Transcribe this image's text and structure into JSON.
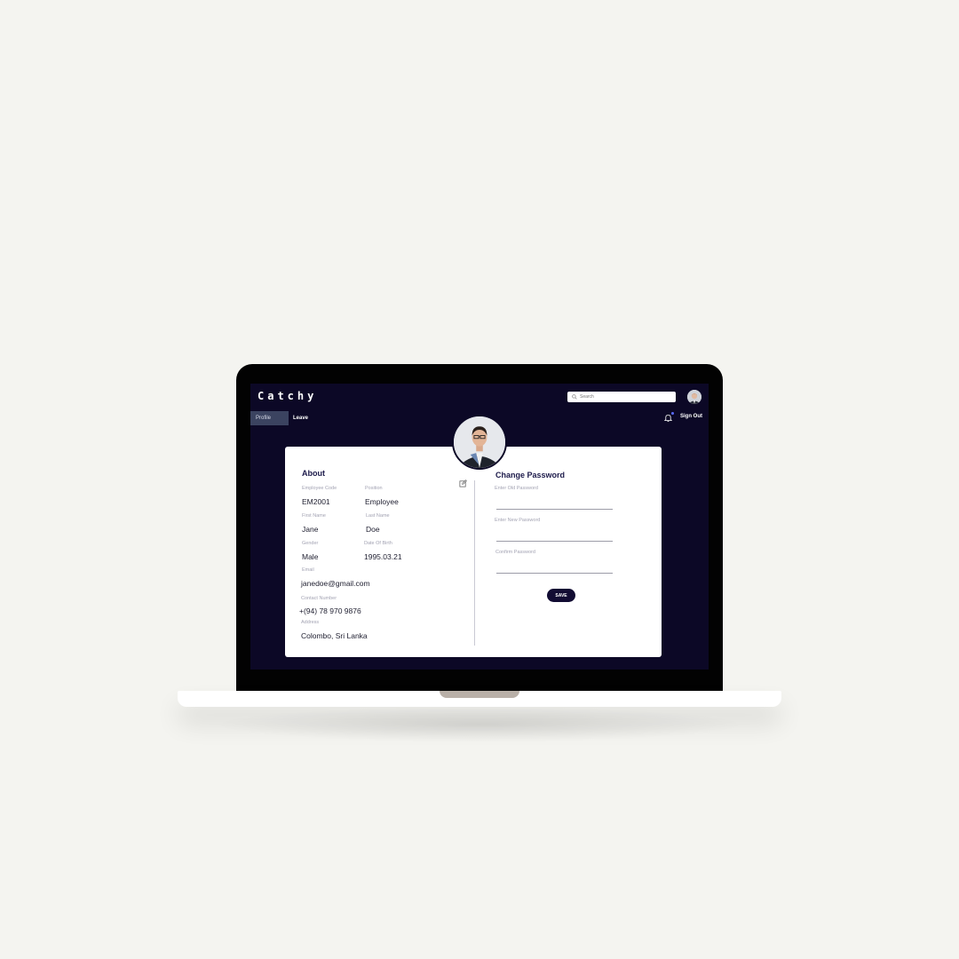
{
  "app": {
    "logo": "Catchy",
    "accent_color": "#0c0826",
    "search": {
      "placeholder": "Search",
      "icon": "search-icon"
    }
  },
  "nav": {
    "tabs": [
      {
        "label": "Profile",
        "active": true
      },
      {
        "label": "Leave",
        "active": false
      }
    ],
    "notification_icon": "bell-icon",
    "sign_out_label": "Sign Out"
  },
  "about": {
    "title": "About",
    "employee_code": {
      "label": "Employee Code",
      "value": "EM2001"
    },
    "position": {
      "label": "Position",
      "value": "Employee"
    },
    "first_name": {
      "label": "First Name",
      "value": "Jane"
    },
    "last_name": {
      "label": "Last Name",
      "value": "Doe"
    },
    "gender": {
      "label": "Gender",
      "value": "Male"
    },
    "dob": {
      "label": "Date Of Birth",
      "value": "1995.03.21"
    },
    "email": {
      "label": "Email",
      "value": "janedoe@gmail.com"
    },
    "contact": {
      "label": "Contact Number",
      "value": "+(94) 78 970 9876"
    },
    "address": {
      "label": "Address",
      "value": "Colombo, Sri Lanka"
    },
    "edit_icon": "edit-icon"
  },
  "change_password": {
    "title": "Change Password",
    "old_label": "Enter Old Password",
    "new_label": "Enter New Password",
    "confirm_label": "Confirm Password",
    "save_label": "SAVE"
  }
}
